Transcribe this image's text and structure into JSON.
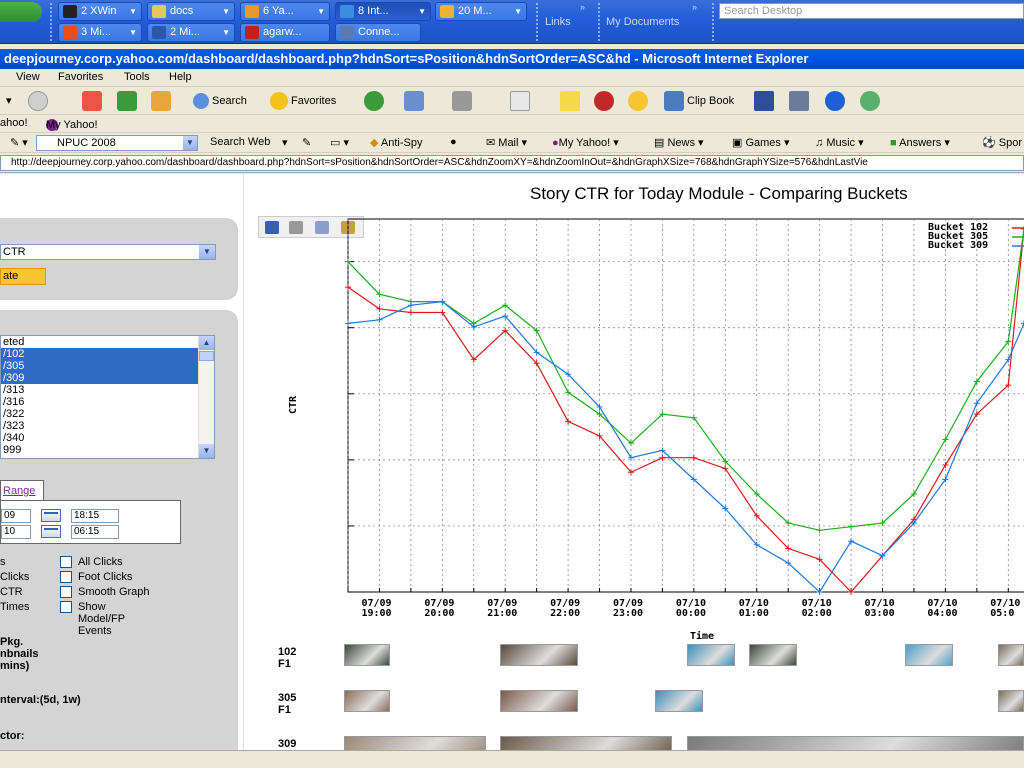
{
  "taskbar": {
    "row1": [
      {
        "label": "2 XWin",
        "color": "#222"
      },
      {
        "label": "docs",
        "color": "#e6c85a"
      },
      {
        "label": "6 Ya...",
        "color": "#e69a2a"
      },
      {
        "label": "8 Int...",
        "color": "#3b8de0",
        "active": true
      },
      {
        "label": "20 M...",
        "color": "#f0b030"
      }
    ],
    "row2": [
      {
        "label": "3 Mi...",
        "color": "#e05020"
      },
      {
        "label": "2 Mi...",
        "color": "#2b57a8"
      },
      {
        "label": "agarw...",
        "color": "#c02020"
      },
      {
        "label": "Conne...",
        "color": "#5a7ab0"
      }
    ],
    "links_label": "Links",
    "mydocs_label": "My Documents",
    "chevron": "»",
    "desktop_search_placeholder": "Search Desktop"
  },
  "window": {
    "title": "deepjourney.corp.yahoo.com/dashboard/dashboard.php?hdnSort=sPosition&hdnSortOrder=ASC&hd - Microsoft Internet Explorer"
  },
  "menu": [
    "View",
    "Favorites",
    "Tools",
    "Help"
  ],
  "toolbar": {
    "search": "Search",
    "favorites": "Favorites",
    "clipbook": "Clip Book"
  },
  "links": {
    "yahoo": "ahoo!",
    "my_yahoo": "My Yahoo!"
  },
  "ytoolbar": {
    "search_value": "NPUC 2008",
    "search_web": "Search Web",
    "anti_spy": "Anti-Spy",
    "mail": "Mail",
    "my_yahoo": "My Yahoo!",
    "news": "News",
    "games": "Games",
    "music": "Music",
    "answers": "Answers",
    "sports": "Spor"
  },
  "address": {
    "url": "http://deepjourney.corp.yahoo.com/dashboard/dashboard.php?hdnSort=sPosition&hdnSortOrder=ASC&hdnZoomXY=&hdnZoomInOut=&hdnGraphXSize=768&hdnGraphYSize=576&hdnLastVie"
  },
  "left": {
    "metric_select": "CTR",
    "update_label": "ate",
    "buckets": [
      {
        "label": "eted",
        "selected": false
      },
      {
        "label": "/102",
        "selected": true
      },
      {
        "label": "/305",
        "selected": true
      },
      {
        "label": "/309",
        "selected": true
      },
      {
        "label": "/313",
        "selected": false
      },
      {
        "label": "/316",
        "selected": false
      },
      {
        "label": "/322",
        "selected": false
      },
      {
        "label": "/323",
        "selected": false
      },
      {
        "label": "/340",
        "selected": false
      },
      {
        "label": "999",
        "selected": false
      }
    ],
    "range_tab": "Range",
    "date_from": "09",
    "time_from": "18:15",
    "date_to": "10",
    "time_to": "06:15",
    "options_left": [
      "s",
      "Clicks",
      "CTR",
      "Times"
    ],
    "options_right": [
      "All Clicks",
      "Foot Clicks",
      "Smooth Graph",
      "Show Model/FP Events"
    ],
    "pkg_text": [
      "Pkg.",
      "nbnails",
      "mins)"
    ],
    "interval": "nterval:(5d, 1w)",
    "factor": "ctor:"
  },
  "chart_data": {
    "type": "line",
    "title": "Story CTR for Today Module - Comparing Buckets",
    "xlabel": "Time",
    "ylabel": "CTR",
    "categories": [
      "07/09 19:00",
      "07/09 20:00",
      "07/09 21:00",
      "07/09 22:00",
      "07/09 23:00",
      "07/10 00:00",
      "07/10 01:00",
      "07/10 02:00",
      "07/10 03:00",
      "07/10 04:00",
      "07/10 05:0"
    ],
    "x": [
      18.5,
      18.75,
      19.0,
      19.25,
      19.5,
      19.75,
      20.0,
      20.25,
      20.5,
      20.75,
      21.0,
      21.25,
      21.5,
      21.75,
      22.0,
      22.25,
      22.5,
      22.75,
      23.0,
      23.25,
      23.5,
      23.75,
      24.0,
      24.25,
      24.5,
      24.75,
      25.0,
      25.25,
      25.5,
      25.75,
      26.0,
      26.25,
      26.5,
      26.75,
      27.0,
      27.25,
      27.5,
      27.75,
      28.0,
      28.25,
      28.5,
      28.75,
      29.0,
      29.25
    ],
    "series": [
      {
        "name": "Bucket 102",
        "color": "#e01818",
        "values": [
          null,
          null,
          null,
          null,
          null,
          null,
          null,
          null,
          null,
          null,
          null,
          null,
          null,
          null,
          null,
          null,
          null,
          null,
          null,
          null,
          null,
          null,
          null,
          null,
          null,
          null,
          null,
          null,
          null,
          null,
          null,
          null,
          null,
          null,
          null,
          null,
          null,
          null,
          null,
          null,
          null,
          null,
          null,
          null
        ]
      },
      {
        "name": "Bucket 305",
        "color": "#18b018",
        "values": []
      },
      {
        "name": "Bucket 309",
        "color": "#1a7ae0",
        "values": []
      }
    ],
    "points": {
      "Bucket 102": [
        [
          18.5,
          0.84
        ],
        [
          19.0,
          0.78
        ],
        [
          19.5,
          0.77
        ],
        [
          20.0,
          0.77
        ],
        [
          20.5,
          0.64
        ],
        [
          21.0,
          0.72
        ],
        [
          21.5,
          0.63
        ],
        [
          22.0,
          0.47
        ],
        [
          22.5,
          0.43
        ],
        [
          23.0,
          0.33
        ],
        [
          23.5,
          0.37
        ],
        [
          24.0,
          0.37
        ],
        [
          24.5,
          0.34
        ],
        [
          25.0,
          0.21
        ],
        [
          25.5,
          0.12
        ],
        [
          26.0,
          0.09
        ],
        [
          26.5,
          0.0
        ],
        [
          27.0,
          0.1
        ],
        [
          27.5,
          0.2
        ],
        [
          28.0,
          0.35
        ],
        [
          28.5,
          0.49
        ],
        [
          29.0,
          0.57
        ],
        [
          29.25,
          1.0
        ]
      ],
      "Bucket 305": [
        [
          18.5,
          0.91
        ],
        [
          19.0,
          0.82
        ],
        [
          19.5,
          0.8
        ],
        [
          20.0,
          0.8
        ],
        [
          20.5,
          0.74
        ],
        [
          21.0,
          0.79
        ],
        [
          21.5,
          0.72
        ],
        [
          22.0,
          0.55
        ],
        [
          22.5,
          0.49
        ],
        [
          23.0,
          0.41
        ],
        [
          23.5,
          0.49
        ],
        [
          24.0,
          0.48
        ],
        [
          24.5,
          0.36
        ],
        [
          25.0,
          0.27
        ],
        [
          25.5,
          0.19
        ],
        [
          26.0,
          0.17
        ],
        [
          26.5,
          0.18
        ],
        [
          27.0,
          0.19
        ],
        [
          27.5,
          0.27
        ],
        [
          28.0,
          0.42
        ],
        [
          28.5,
          0.58
        ],
        [
          29.0,
          0.69
        ],
        [
          29.25,
          1.0
        ]
      ],
      "Bucket 309": [
        [
          18.5,
          0.74
        ],
        [
          19.0,
          0.75
        ],
        [
          19.5,
          0.79
        ],
        [
          20.0,
          0.8
        ],
        [
          20.5,
          0.73
        ],
        [
          21.0,
          0.76
        ],
        [
          21.5,
          0.66
        ],
        [
          22.0,
          0.6
        ],
        [
          22.5,
          0.51
        ],
        [
          23.0,
          0.37
        ],
        [
          23.5,
          0.39
        ],
        [
          24.0,
          0.31
        ],
        [
          24.5,
          0.23
        ],
        [
          25.0,
          0.13
        ],
        [
          25.5,
          0.08
        ],
        [
          26.0,
          0.0
        ],
        [
          26.5,
          0.14
        ],
        [
          27.0,
          0.1
        ],
        [
          27.5,
          0.19
        ],
        [
          28.0,
          0.31
        ],
        [
          28.5,
          0.52
        ],
        [
          29.0,
          0.64
        ],
        [
          29.25,
          0.74
        ]
      ]
    },
    "xlim": [
      18.5,
      29.25
    ],
    "ylim": [
      0,
      1
    ],
    "grid": true,
    "legend": "top-right",
    "y_axis_labels": "none"
  },
  "thumbnails": {
    "rows": [
      {
        "label1": "102",
        "label2": "F1"
      },
      {
        "label1": "305",
        "label2": "F1"
      },
      {
        "label1": "309",
        "label2": ""
      }
    ]
  }
}
